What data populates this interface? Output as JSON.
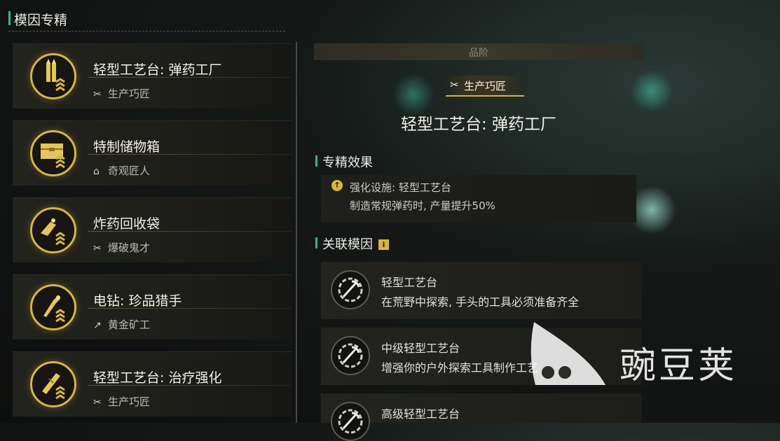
{
  "section": {
    "title": "模因专精"
  },
  "gene_list": [
    {
      "name": "轻型工艺台: 弹药工厂",
      "category": "生产巧匠",
      "category_icon": "crossed-tools-icon",
      "badge_icon": "ammo-icon"
    },
    {
      "name": "特制储物箱",
      "category": "奇观匠人",
      "category_icon": "house-icon",
      "badge_icon": "crate-icon"
    },
    {
      "name": "炸药回收袋",
      "category": "爆破鬼才",
      "category_icon": "crossed-tools-icon",
      "badge_icon": "explosive-bag-icon"
    },
    {
      "name": "电钻: 珍品猎手",
      "category": "黄金矿工",
      "category_icon": "pickaxe-icon",
      "badge_icon": "drill-icon"
    },
    {
      "name": "轻型工艺台: 治疗强化",
      "category": "生产巧匠",
      "category_icon": "crossed-tools-icon",
      "badge_icon": "medkit-icon"
    }
  ],
  "detail": {
    "grade_label": "品阶",
    "tag": "生产巧匠",
    "title": "轻型工艺台: 弹药工厂",
    "effect_header": "专精效果",
    "effect_line1": "强化设施: 轻型工艺台",
    "effect_line2": "制造常规弹药时, 产量提升50%",
    "related_header": "关联模因",
    "related": [
      {
        "name": "轻型工艺台",
        "desc": "在荒野中探索, 手头的工具必须准备齐全"
      },
      {
        "name": "中级轻型工艺台",
        "desc": "增强你的户外探索工具制作工艺"
      },
      {
        "name": "高级轻型工艺台",
        "desc": ""
      }
    ]
  },
  "watermark": {
    "text": "豌豆荚"
  },
  "colors": {
    "accent": "#36b39a",
    "gold": "#d6b642",
    "background": "#141816"
  }
}
